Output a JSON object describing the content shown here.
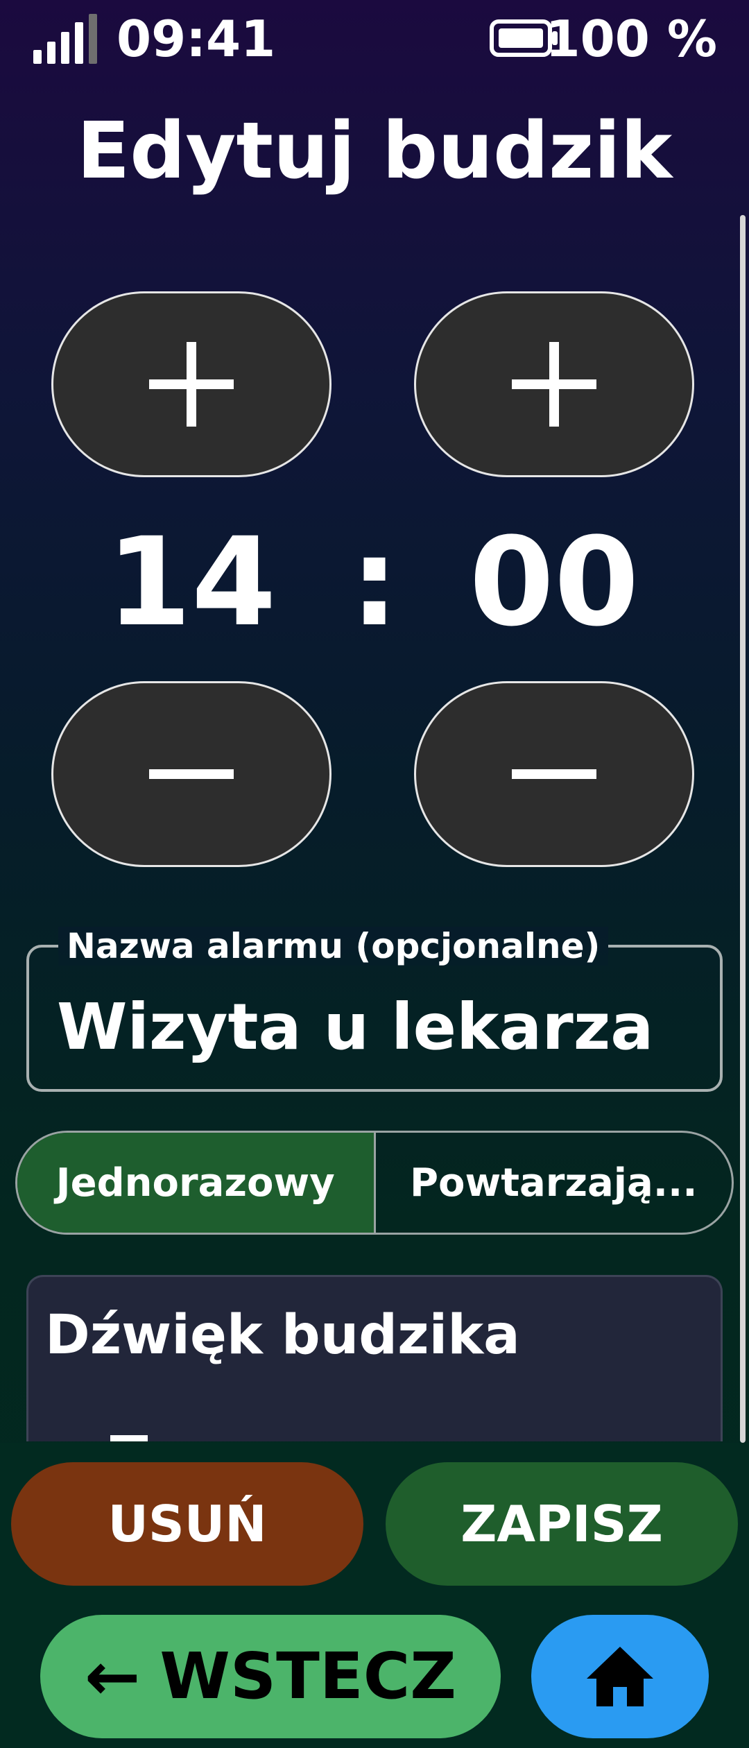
{
  "status_bar": {
    "time": "09:41",
    "battery": "100 %"
  },
  "title": "Edytuj budzik",
  "time_picker": {
    "hour": "14",
    "separator": ":",
    "minute": "00"
  },
  "alarm_name": {
    "label": "Nazwa alarmu (opcjonalne)",
    "value": "Wizyta u lekarza"
  },
  "repeat_mode": {
    "options": [
      "Jednorazowy",
      "Powtarzają..."
    ],
    "selected": "Jednorazowy"
  },
  "sound": {
    "title": "Dźwięk budzika"
  },
  "actions": {
    "delete_label": "USUŃ",
    "save_label": "ZAPISZ",
    "back_label": "WSTECZ",
    "back_arrow": "←"
  },
  "colors": {
    "delete": "#7a3410",
    "save": "#1f5e2c",
    "back": "#4cb46a",
    "home": "#2a9bf2",
    "selected_segment": "#1e5e2e"
  },
  "icons": {
    "signal": "signal-icon",
    "battery": "battery-icon",
    "plus": "plus-icon",
    "minus": "minus-icon",
    "home": "home-icon"
  }
}
